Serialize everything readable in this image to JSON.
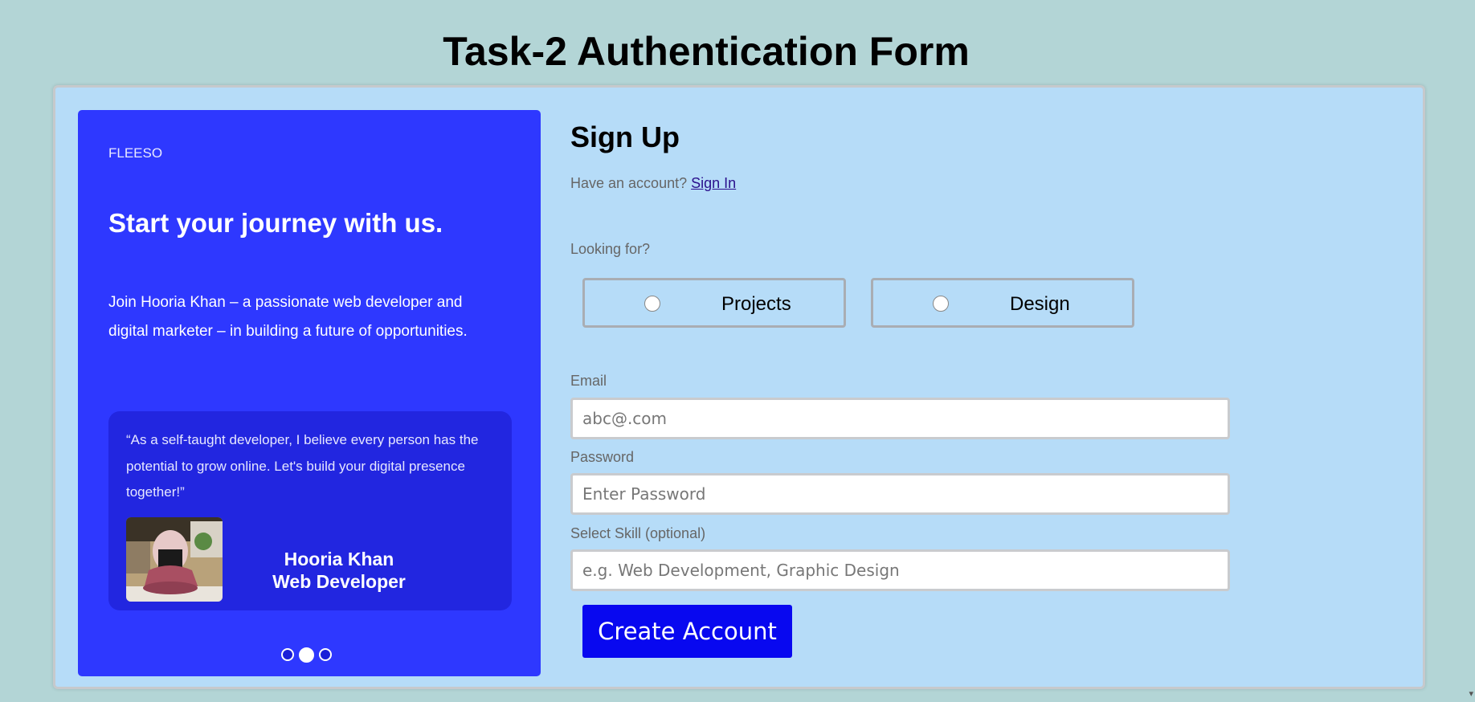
{
  "page_title": "Task-2 Authentication Form",
  "promo": {
    "brand": "FLEESO",
    "headline": "Start your journey with us.",
    "intro": "Join Hooria Khan – a passionate web developer and digital marketer – in building a future of opportunities.",
    "testimonial": {
      "quote": "“As a self-taught developer, I believe every person has the potential to grow online. Let's build your digital presence together!”",
      "name": "Hooria Khan",
      "role": "Web Developer"
    },
    "carousel": {
      "count": 3,
      "active_index": 1
    }
  },
  "form": {
    "title": "Sign Up",
    "have_account_text": "Have an account?",
    "signin_link": "Sign In",
    "looking_for_label": "Looking for?",
    "options": [
      {
        "label": "Projects",
        "selected": false
      },
      {
        "label": "Design",
        "selected": false
      }
    ],
    "email": {
      "label": "Email",
      "value": "",
      "placeholder": "abc@.com"
    },
    "password": {
      "label": "Password",
      "value": "",
      "placeholder": "Enter Password"
    },
    "skill": {
      "label": "Select Skill (optional)",
      "value": "",
      "placeholder": "e.g. Web Development, Graphic Design"
    },
    "submit_label": "Create Account"
  },
  "colors": {
    "page_bg": "#b3d5d6",
    "card_bg": "#b6dcf8",
    "promo_bg": "#2e38ff",
    "testimonial_bg": "#2226e0",
    "button_bg": "#0808f0"
  }
}
